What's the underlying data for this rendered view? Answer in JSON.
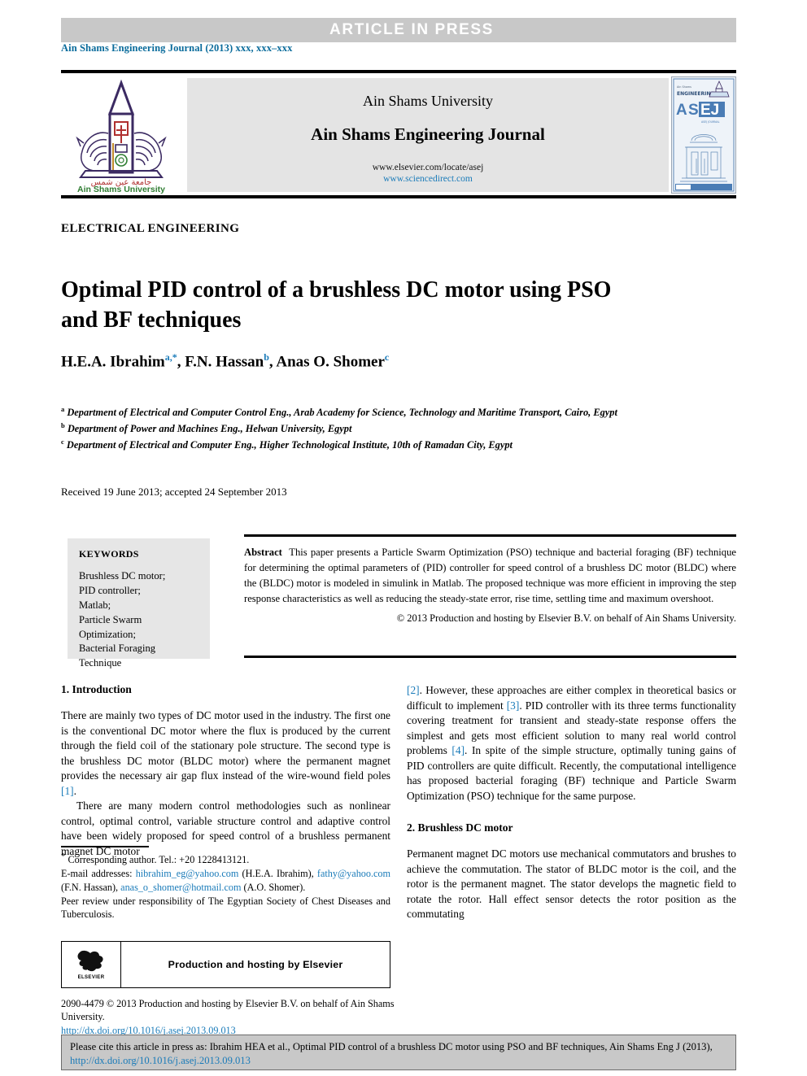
{
  "banner": {
    "article_in_press": "ARTICLE  IN  PRESS"
  },
  "running_head": "Ain Shams Engineering Journal (2013) xxx, xxx–xxx",
  "masthead": {
    "university": "Ain Shams University",
    "journal": "Ain Shams Engineering Journal",
    "url_elsevier": "www.elsevier.com/locate/asej",
    "url_sciencedirect": "www.sciencedirect.com",
    "logo_caption_arabic": "جامعة عين شمس",
    "logo_caption": "Ain Shams University",
    "cover_title_small": "Ain Shams",
    "cover_title_engineering": "ENGINEERING",
    "cover_acronym": "ASEJ",
    "cover_subtitle": "ASEJ JOURNAL"
  },
  "subject_heading": "ELECTRICAL ENGINEERING",
  "title": "Optimal PID control of a brushless DC motor using PSO and BF techniques",
  "authors": [
    {
      "name": "H.E.A. Ibrahim",
      "marks": "a,*"
    },
    {
      "name": "F.N. Hassan",
      "marks": "b"
    },
    {
      "name": "Anas O. Shomer",
      "marks": "c"
    }
  ],
  "affiliations": [
    {
      "mark": "a",
      "text": "Department of Electrical and Computer Control Eng., Arab Academy for Science, Technology and Maritime Transport, Cairo, Egypt"
    },
    {
      "mark": "b",
      "text": "Department of Power and Machines Eng., Helwan University, Egypt"
    },
    {
      "mark": "c",
      "text": "Department of Electrical and Computer Eng., Higher Technological Institute, 10th of Ramadan City, Egypt"
    }
  ],
  "dates": "Received 19 June 2013; accepted 24 September 2013",
  "keywords": {
    "title": "KEYWORDS",
    "items": [
      "Brushless DC motor;",
      "PID controller;",
      "Matlab;",
      "Particle Swarm",
      "Optimization;",
      "Bacterial Foraging",
      "Technique"
    ]
  },
  "abstract": {
    "label": "Abstract",
    "text": "This paper presents a Particle Swarm Optimization (PSO) technique and bacterial foraging (BF) technique for determining the optimal parameters of (PID) controller for speed control of a brushless DC motor (BLDC) where the (BLDC) motor is modeled in simulink in Matlab. The proposed technique was more efficient in improving the step response characteristics as well as reducing the steady-state error, rise time, settling time and maximum overshoot.",
    "copyright": "© 2013 Production and hosting by Elsevier B.V. on behalf of Ain Shams University."
  },
  "sections": {
    "introduction": {
      "heading": "1. Introduction",
      "p1_a": "There are mainly two types of DC motor used in the industry. The first one is the conventional DC motor where the flux is produced by the current through the field coil of the stationary pole structure. The second type is the brushless DC motor (BLDC motor) where the permanent magnet provides the necessary air gap flux instead of the wire-wound field poles ",
      "p1_ref": "[1]",
      "p1_b": ".",
      "p2_a": "There are many modern control methodologies such as nonlinear control, optimal control, variable structure control and adaptive control have been widely proposed for speed control of a brushless permanent magnet DC motor ",
      "p2_ref1": "[2]",
      "p2_b": ". However, these approaches are either complex in theoretical basics or difficult to implement ",
      "p2_ref2": "[3]",
      "p2_c": ". PID controller with its three terms functionality covering treatment for transient and steady-state response offers the simplest and gets most efficient solution to many real world control problems ",
      "p2_ref3": "[4]",
      "p2_d": ". In spite of the simple structure, optimally tuning gains of PID controllers are quite difficult. Recently, the computational intelligence has proposed bacterial foraging (BF) technique and Particle Swarm Optimization (PSO) technique for the same purpose."
    },
    "bldc": {
      "heading": "2. Brushless DC motor",
      "p1": "Permanent magnet DC motors use mechanical commutators and brushes to achieve the commutation. The stator of BLDC motor is the coil, and the rotor is the permanent magnet. The stator develops the magnetic field to rotate the rotor. Hall effect sensor detects the rotor position as the commutating"
    }
  },
  "footnotes": {
    "corresponding": "Corresponding author. Tel.: +20 1228413121.",
    "email_label": "E-mail addresses:",
    "email1": "hibrahim_eg@yahoo.com",
    "email1_owner": "(H.E.A. Ibrahim),",
    "email2": "fathy@yahoo.com",
    "email2_owner": "(F.N. Hassan),",
    "email3": "anas_o_shomer@hotmail.com",
    "email3_owner": "(A.O. Shomer).",
    "peer_review": "Peer review under responsibility of The Egyptian Society of Chest Diseases and Tuberculosis."
  },
  "elsevier_box": {
    "label": "Production and hosting by Elsevier",
    "wordmark": "ELSEVIER"
  },
  "issn_line": {
    "text": "2090-4479 © 2013 Production and hosting by Elsevier B.V. on behalf of Ain Shams University.",
    "doi": "http://dx.doi.org/10.1016/j.asej.2013.09.013"
  },
  "cite_box": {
    "text_a": "Please cite this article in press as: Ibrahim HEA et al., Optimal PID control of a brushless DC motor using PSO and BF techniques, Ain Shams Eng J (2013), ",
    "doi": "http://dx.doi.org/10.1016/j.asej.2013.09.013"
  },
  "colors": {
    "link_blue": "#1a7bb9",
    "banner_gray": "#c8c8c8",
    "panel_gray": "#e6e6e6",
    "logo_purple": "#3b2a62"
  }
}
